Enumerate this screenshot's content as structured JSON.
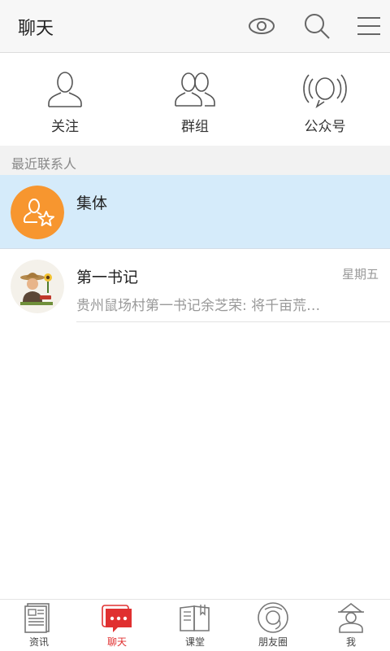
{
  "header": {
    "title": "聊天",
    "icons": [
      "eye-icon",
      "search-icon",
      "menu-icon"
    ]
  },
  "quick_entries": [
    {
      "label": "关注",
      "icon": "person-icon"
    },
    {
      "label": "群组",
      "icon": "group-icon"
    },
    {
      "label": "公众号",
      "icon": "broadcast-icon"
    }
  ],
  "section": {
    "title": "最近联系人"
  },
  "chats": [
    {
      "name": "集体",
      "time": "",
      "message": "",
      "avatar": "group-star-avatar",
      "highlighted": true
    },
    {
      "name": "第一书记",
      "time": "星期五",
      "message": "贵州鼠场村第一书记余芝荣: 将千亩荒…",
      "avatar": "farmer-avatar",
      "highlighted": false
    }
  ],
  "bottom_nav": [
    {
      "label": "资讯",
      "icon": "news-icon",
      "active": false
    },
    {
      "label": "聊天",
      "icon": "chat-bubble-icon",
      "active": true
    },
    {
      "label": "课堂",
      "icon": "book-icon",
      "active": false
    },
    {
      "label": "朋友圈",
      "icon": "camera-lens-icon",
      "active": false
    },
    {
      "label": "我",
      "icon": "profile-icon",
      "active": false
    }
  ],
  "colors": {
    "accent": "#e03030",
    "avatar_orange": "#f7962f",
    "highlight_row": "#d5ebfa",
    "section_bg": "#f2f2f2"
  }
}
